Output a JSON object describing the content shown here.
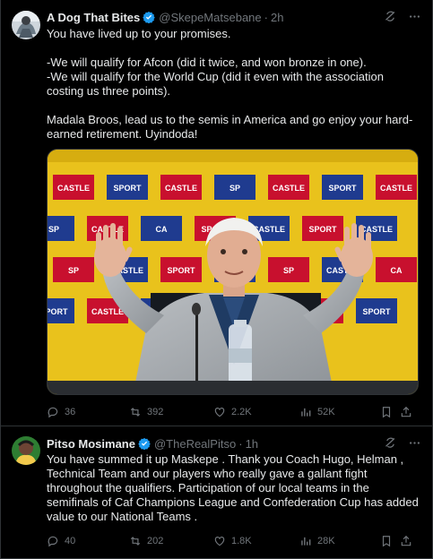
{
  "tweet1": {
    "display_name": "A Dog That Bites",
    "handle": "@SkepeMatsebane",
    "time": "2h",
    "text": "You have lived up to your promises.\n\n-We will qualify for Afcon (did it twice, and won bronze in one).\n-We will qualify for the World Cup (did it even with the association costing us three points).\n\nMadala Broos, lead us to the semis in America and go enjoy your hard-earned retirement. Uyindoda!",
    "stats": {
      "replies": "36",
      "reposts": "392",
      "likes": "2.2K",
      "views": "52K"
    },
    "media_board": [
      "CASTLE",
      "SPORT",
      "CASTLE",
      "SP",
      "CASTLE",
      "SPORT",
      "CASTLE",
      "SP",
      "CASTLE",
      "CA",
      "SPORT"
    ]
  },
  "tweet2": {
    "display_name": "Pitso Mosimane",
    "handle": "@TheRealPitso",
    "time": "1h",
    "text": "You have summed it up Maskepe . Thank you Coach Hugo, Helman , Technical Team and our players who really gave a gallant fight throughout the qualifiers. Participation of our local teams in the semifinals of Caf Champions League and Confederation Cup has added value to our National Teams .",
    "stats": {
      "replies": "40",
      "reposts": "202",
      "likes": "1.8K",
      "views": "28K"
    }
  },
  "colors": {
    "background": "#000000",
    "text": "#e7e9ea",
    "muted": "#71767b",
    "verified": "#1d9bf0",
    "border": "#2f3336"
  },
  "icons": [
    "verified-badge-icon",
    "grok-icon",
    "more-icon",
    "reply-icon",
    "repost-icon",
    "like-icon",
    "views-icon",
    "bookmark-icon",
    "share-icon"
  ]
}
